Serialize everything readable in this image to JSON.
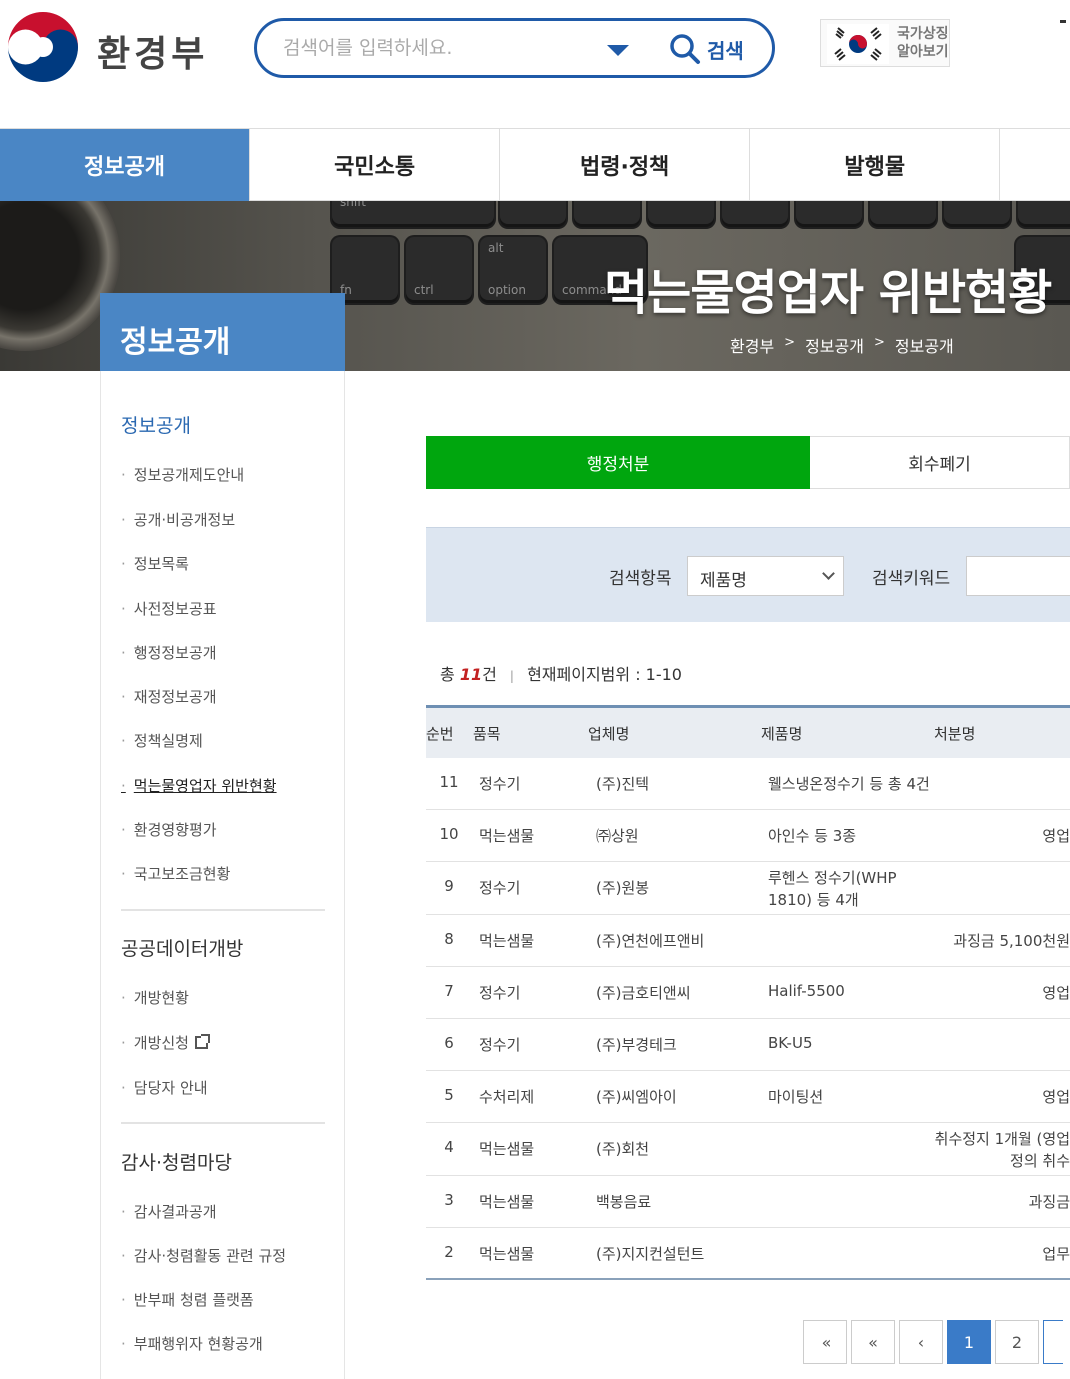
{
  "header": {
    "logo_text": "환경부",
    "search_placeholder": "검색어를 입력하세요.",
    "search_button": "검색",
    "flag_line1": "국가상징",
    "flag_line2": "알아보기"
  },
  "gnb": [
    "정보공개",
    "국민소통",
    "법령·정책",
    "발행물"
  ],
  "visual": {
    "title": "먹는물영업자 위반현황",
    "side_title": "정보공개",
    "breadcrumb": [
      "환경부",
      "정보공개",
      "정보공개"
    ],
    "keys": [
      "shift",
      "fn",
      "ctrl",
      "alt",
      "option",
      "command"
    ]
  },
  "sidebar": {
    "section1": "정보공개",
    "links1": [
      "정보공개제도안내",
      "공개·비공개정보",
      "정보목록",
      "사전정보공표",
      "행정정보공개",
      "재정정보공개",
      "정책실명제",
      "먹는물영업자 위반현황",
      "환경영향평가",
      "국고보조금현황"
    ],
    "section2": "공공데이터개방",
    "links2": [
      "개방현황",
      "개방신청",
      "담당자 안내"
    ],
    "section3": "감사·청렴마당",
    "links3": [
      "감사결과공개",
      "감사·청렴활동 관련 규정",
      "반부패 청렴 플랫폼",
      "부패행위자 현황공개"
    ]
  },
  "tabs": [
    "행정처분",
    "회수폐기"
  ],
  "search": {
    "label1": "검색항목",
    "select_value": "제품명",
    "label2": "검색키워드"
  },
  "count": {
    "prefix": "총",
    "num": "11",
    "suffix": "건",
    "range": "현재페이지범위 : 1-10"
  },
  "table": {
    "headers": [
      "순번",
      "품목",
      "업체명",
      "제품명",
      "처분명"
    ],
    "rows": [
      {
        "no": "11",
        "item": "정수기",
        "company": "(주)진텍",
        "product": "웰스냉온정수기 등 총 4건",
        "product2": "",
        "disp": "",
        "disp2": ""
      },
      {
        "no": "10",
        "item": "먹는샘물",
        "company": "㈜상원",
        "product": "아인수 등 3종",
        "product2": "",
        "disp": "영업",
        "disp2": ""
      },
      {
        "no": "9",
        "item": "정수기",
        "company": "(주)원봉",
        "product": "루헨스 정수기(WHP",
        "product2": "1810) 등 4개",
        "disp": "",
        "disp2": ""
      },
      {
        "no": "8",
        "item": "먹는샘물",
        "company": "(주)연천에프앤비",
        "product": "",
        "product2": "",
        "disp": "과징금 5,100천원",
        "disp2": ""
      },
      {
        "no": "7",
        "item": "정수기",
        "company": "(주)금호티앤씨",
        "product": "Halif-5500",
        "product2": "",
        "disp": "영업",
        "disp2": ""
      },
      {
        "no": "6",
        "item": "정수기",
        "company": "(주)부경테크",
        "product": "BK-U5",
        "product2": "",
        "disp": "",
        "disp2": ""
      },
      {
        "no": "5",
        "item": "수처리제",
        "company": "(주)씨엠아이",
        "product": "마이팅션",
        "product2": "",
        "disp": "영업",
        "disp2": ""
      },
      {
        "no": "4",
        "item": "먹는샘물",
        "company": "(주)회천",
        "product": "",
        "product2": "",
        "disp": "취수정지 1개월 (영업",
        "disp2": "정의 취수"
      },
      {
        "no": "3",
        "item": "먹는샘물",
        "company": "백봉음료",
        "product": "",
        "product2": "",
        "disp": "과징금",
        "disp2": ""
      },
      {
        "no": "2",
        "item": "먹는샘물",
        "company": "(주)지지컨설턴트",
        "product": "",
        "product2": "",
        "disp": "업무",
        "disp2": ""
      }
    ]
  },
  "pagination": {
    "first": "«",
    "prev_group": "«",
    "prev": "‹",
    "pages": [
      "1",
      "2"
    ]
  },
  "colors": {
    "brand_blue": "#4a86c5",
    "tab_green": "#00a60e",
    "count_red": "#c32222"
  }
}
